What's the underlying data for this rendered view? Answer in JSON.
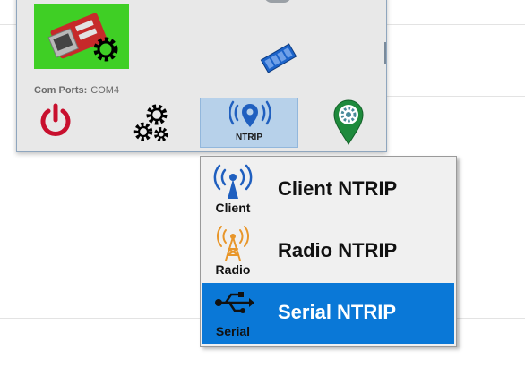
{
  "window": {
    "com_ports_label": "Com Ports:",
    "com_ports_value": "COM4"
  },
  "toolbar": {
    "power_icon": "power-icon",
    "settings_icon": "gears-icon",
    "ntrip_label": "NTRIP",
    "ntrip_icon": "antenna-pin-icon",
    "map_icon": "location-pin-icon"
  },
  "menu": {
    "items": [
      {
        "icon": "broadcast-antenna-icon",
        "icon_label": "Client",
        "label": "Client NTRIP",
        "selected": false
      },
      {
        "icon": "radio-tower-icon",
        "icon_label": "Radio",
        "label": "Radio NTRIP",
        "selected": false
      },
      {
        "icon": "usb-icon",
        "icon_label": "Serial",
        "label": "Serial NTRIP",
        "selected": true
      }
    ]
  },
  "colors": {
    "highlight": "#0a78d7",
    "toolbar_active": "#b7d1ea",
    "tile_green": "#3fcf25",
    "power_red": "#c8102e",
    "icon_blue": "#1f5fbf",
    "radio_orange": "#e8962a"
  }
}
